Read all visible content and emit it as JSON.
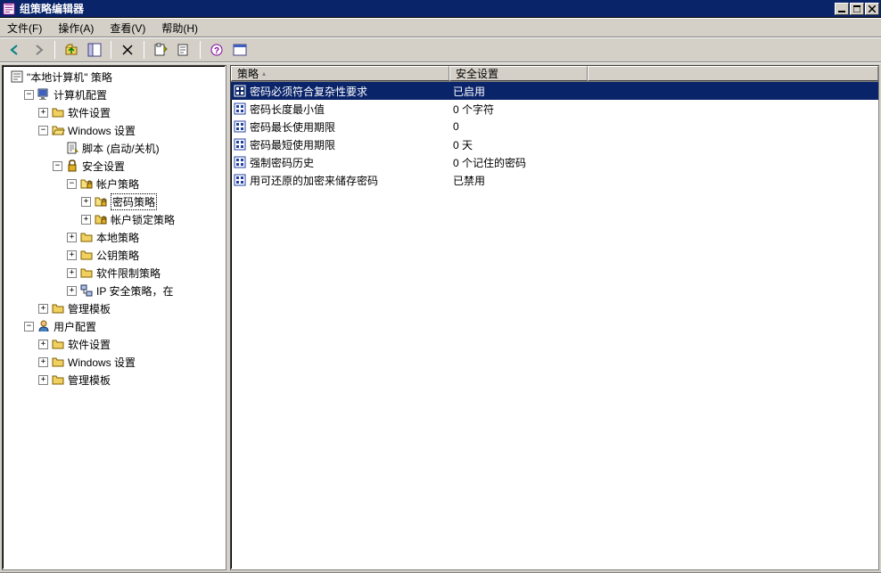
{
  "title": "组策略编辑器",
  "menus": {
    "file": "文件(F)",
    "action": "操作(A)",
    "view": "查看(V)",
    "help": "帮助(H)"
  },
  "tree": {
    "root": "\"本地计算机\" 策略",
    "computer_cfg": "计算机配置",
    "comp_soft": "软件设置",
    "comp_win": "Windows 设置",
    "script": "脚本 (启动/关机)",
    "sec": "安全设置",
    "acct": "帐户策略",
    "pwd": "密码策略",
    "lockout": "帐户锁定策略",
    "local": "本地策略",
    "pubkey": "公钥策略",
    "swrestrict": "软件限制策略",
    "ipsec": "IP 安全策略，在",
    "admintpl1": "管理模板",
    "user_cfg": "用户配置",
    "user_soft": "软件设置",
    "user_win": "Windows 设置",
    "admintpl2": "管理模板"
  },
  "columns": {
    "policy": "策略",
    "setting": "安全设置"
  },
  "rows": [
    {
      "name": "密码必须符合复杂性要求",
      "value": "已启用"
    },
    {
      "name": "密码长度最小值",
      "value": "0 个字符"
    },
    {
      "name": "密码最长使用期限",
      "value": "0"
    },
    {
      "name": "密码最短使用期限",
      "value": "0 天"
    },
    {
      "name": "强制密码历史",
      "value": "0 个记住的密码"
    },
    {
      "name": "用可还原的加密来储存密码",
      "value": "已禁用"
    }
  ]
}
